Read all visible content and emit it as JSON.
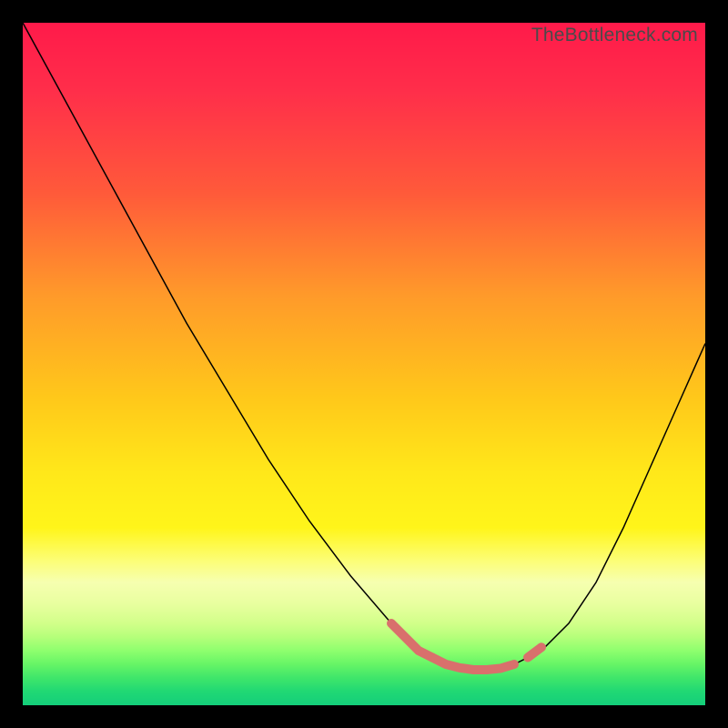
{
  "watermark": "TheBottleneck.com",
  "colors": {
    "accent_stroke": "#d9706c",
    "curve_stroke": "#000000",
    "frame_bg": "#000000"
  },
  "chart_data": {
    "type": "line",
    "title": "",
    "xlabel": "",
    "ylabel": "",
    "xlim": [
      0,
      100
    ],
    "ylim": [
      0,
      100
    ],
    "grid": false,
    "legend": false,
    "note": "Axes are implied by position only; no tick labels, axis titles, or legend are shown. Values below are pixel-proportional estimates (0 = left/bottom, 100 = right/top).",
    "series": [
      {
        "name": "bottleneck-curve",
        "x": [
          0,
          6,
          12,
          18,
          24,
          30,
          36,
          42,
          48,
          54,
          56,
          58,
          60,
          62,
          64,
          66,
          68,
          70,
          72,
          76,
          80,
          84,
          88,
          92,
          96,
          100
        ],
        "y": [
          100,
          89,
          78,
          67,
          56,
          46,
          36,
          27,
          19,
          12,
          10,
          8,
          7,
          6,
          5.5,
          5.2,
          5.2,
          5.4,
          6,
          8,
          12,
          18,
          26,
          35,
          44,
          53
        ]
      }
    ],
    "accent_segments": [
      {
        "name": "left-descent-accent",
        "x": [
          54,
          56,
          58,
          60
        ],
        "y": [
          12,
          10,
          8,
          7
        ]
      },
      {
        "name": "valley-floor-accent",
        "x": [
          60,
          62,
          64,
          66,
          68,
          70,
          72
        ],
        "y": [
          7,
          6,
          5.5,
          5.2,
          5.2,
          5.4,
          6
        ]
      },
      {
        "name": "right-ascent-accent",
        "x": [
          74,
          76
        ],
        "y": [
          7,
          8.5
        ]
      }
    ]
  }
}
